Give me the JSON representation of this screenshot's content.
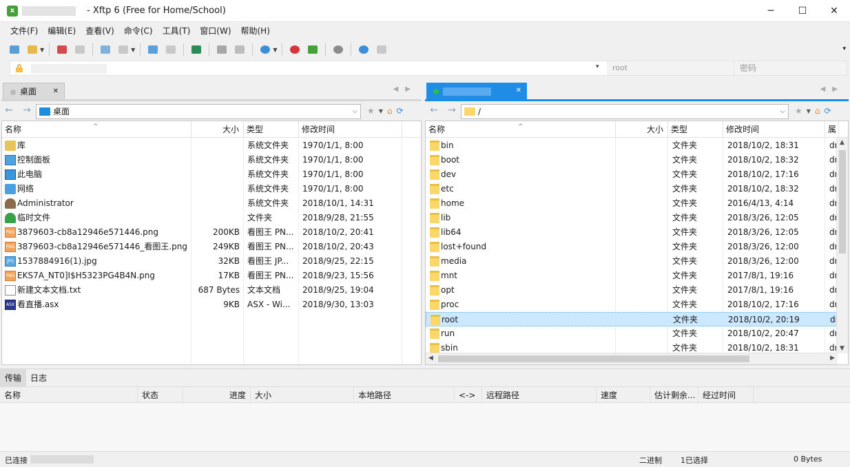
{
  "window": {
    "title": "- Xftp 6 (Free for Home/School)",
    "app_icon_letter": "x",
    "minimize": "─",
    "maximize": "☐",
    "close": "✕"
  },
  "menu": [
    "文件(F)",
    "编辑(E)",
    "查看(V)",
    "命令(C)",
    "工具(T)",
    "窗口(W)",
    "帮助(H)"
  ],
  "toolbar": {
    "overflow_caret": "▾"
  },
  "address": {
    "user_placeholder": "root",
    "password_placeholder": "密码",
    "dropdown": "▾"
  },
  "left_pane": {
    "tab_label": "桌面",
    "path": "桌面",
    "columns": [
      "名称",
      "大小",
      "类型",
      "修改时间"
    ],
    "files": [
      {
        "name": "库",
        "size": "",
        "type": "系统文件夹",
        "mtime": "1970/1/1, 8:00",
        "icon": "library-icon"
      },
      {
        "name": "控制面板",
        "size": "",
        "type": "系统文件夹",
        "mtime": "1970/1/1, 8:00",
        "icon": "control-panel-icon"
      },
      {
        "name": "此电脑",
        "size": "",
        "type": "系统文件夹",
        "mtime": "1970/1/1, 8:00",
        "icon": "computer-icon"
      },
      {
        "name": "网络",
        "size": "",
        "type": "系统文件夹",
        "mtime": "1970/1/1, 8:00",
        "icon": "network-icon"
      },
      {
        "name": "Administrator",
        "size": "",
        "type": "系统文件夹",
        "mtime": "2018/10/1, 14:31",
        "icon": "user-icon"
      },
      {
        "name": "临时文件",
        "size": "",
        "type": "文件夹",
        "mtime": "2018/9/28, 21:55",
        "icon": "tree-folder-icon"
      },
      {
        "name": "3879603-cb8a12946e571446.png",
        "size": "200KB",
        "type": "看图王 PN...",
        "mtime": "2018/10/2, 20:41",
        "icon": "png-file-icon"
      },
      {
        "name": "3879603-cb8a12946e571446_看图王.png",
        "size": "249KB",
        "type": "看图王 PN...",
        "mtime": "2018/10/2, 20:43",
        "icon": "png-file-icon"
      },
      {
        "name": "1537884916(1).jpg",
        "size": "32KB",
        "type": "看图王 JP...",
        "mtime": "2018/9/25, 22:15",
        "icon": "jpg-file-icon"
      },
      {
        "name": "EKS7A_NT0]I$H5323PG4B4N.png",
        "size": "17KB",
        "type": "看图王 PN...",
        "mtime": "2018/9/23, 15:56",
        "icon": "png-file-icon"
      },
      {
        "name": "新建文本文档.txt",
        "size": "687 Bytes",
        "type": "文本文档",
        "mtime": "2018/9/25, 19:04",
        "icon": "txt-file-icon"
      },
      {
        "name": "看直播.asx",
        "size": "9KB",
        "type": "ASX - Wi...",
        "mtime": "2018/9/30, 13:03",
        "icon": "asx-file-icon"
      }
    ]
  },
  "right_pane": {
    "tab_label": "",
    "path": "/",
    "columns": [
      "名称",
      "大小",
      "类型",
      "修改时间",
      "属"
    ],
    "files": [
      {
        "name": "bin",
        "type": "文件夹",
        "mtime": "2018/10/2, 18:31",
        "perm": "dr"
      },
      {
        "name": "boot",
        "type": "文件夹",
        "mtime": "2018/10/2, 18:32",
        "perm": "dr"
      },
      {
        "name": "dev",
        "type": "文件夹",
        "mtime": "2018/10/2, 17:16",
        "perm": "dr"
      },
      {
        "name": "etc",
        "type": "文件夹",
        "mtime": "2018/10/2, 18:32",
        "perm": "dr"
      },
      {
        "name": "home",
        "type": "文件夹",
        "mtime": "2016/4/13, 4:14",
        "perm": "dr"
      },
      {
        "name": "lib",
        "type": "文件夹",
        "mtime": "2018/3/26, 12:05",
        "perm": "dr"
      },
      {
        "name": "lib64",
        "type": "文件夹",
        "mtime": "2018/3/26, 12:05",
        "perm": "dr"
      },
      {
        "name": "lost+found",
        "type": "文件夹",
        "mtime": "2018/3/26, 12:00",
        "perm": "dr"
      },
      {
        "name": "media",
        "type": "文件夹",
        "mtime": "2018/3/26, 12:00",
        "perm": "dr"
      },
      {
        "name": "mnt",
        "type": "文件夹",
        "mtime": "2017/8/1, 19:16",
        "perm": "dr"
      },
      {
        "name": "opt",
        "type": "文件夹",
        "mtime": "2017/8/1, 19:16",
        "perm": "dr"
      },
      {
        "name": "proc",
        "type": "文件夹",
        "mtime": "2018/10/2, 17:16",
        "perm": "dr"
      },
      {
        "name": "root",
        "type": "文件夹",
        "mtime": "2018/10/2, 20:19",
        "perm": "dr",
        "selected": true
      },
      {
        "name": "run",
        "type": "文件夹",
        "mtime": "2018/10/2, 20:47",
        "perm": "dr"
      },
      {
        "name": "sbin",
        "type": "文件夹",
        "mtime": "2018/10/2, 18:31",
        "perm": "dr"
      }
    ]
  },
  "bottom": {
    "tabs": [
      "传输",
      "日志"
    ],
    "columns": [
      "名称",
      "状态",
      "进度",
      "大小",
      "本地路径",
      "<->",
      "远程路径",
      "速度",
      "估计剩余...",
      "经过时间"
    ]
  },
  "status": {
    "connection": "已连接",
    "mode": "二进制",
    "selection": "1已选择",
    "size": "0 Bytes"
  },
  "colors": {
    "accent": "#1f8ce6",
    "selected_row": "#cce8ff",
    "folder": "#f9d76a",
    "connected_dot": "#2fbf3f"
  }
}
